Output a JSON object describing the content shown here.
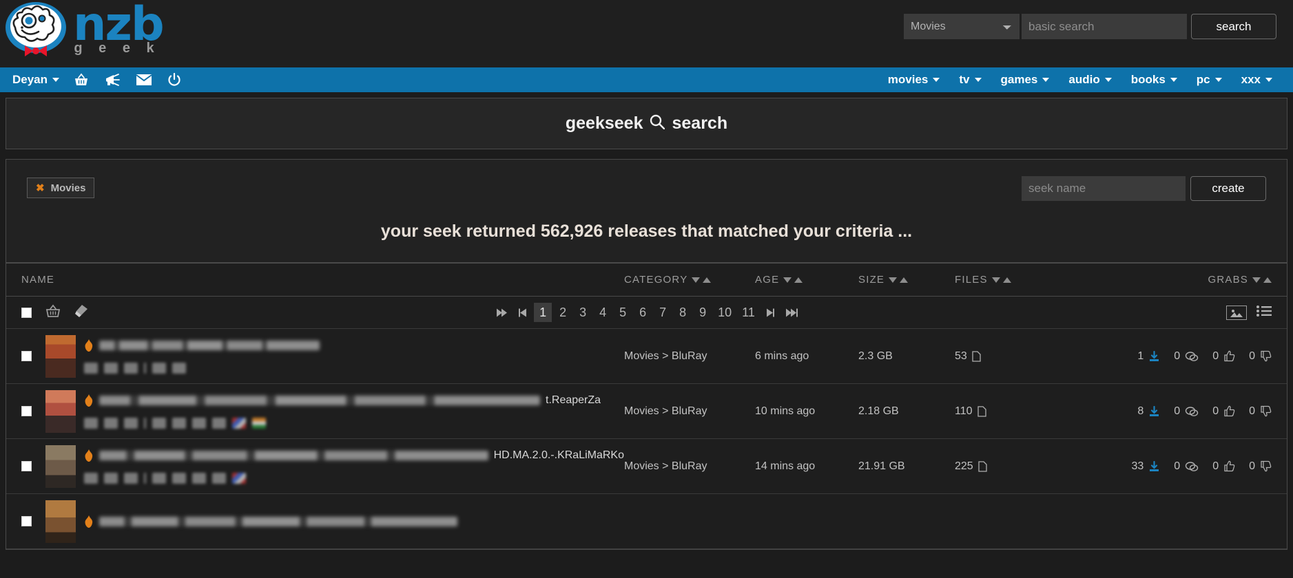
{
  "header": {
    "logo_primary": "nzb",
    "logo_secondary": "g e e k",
    "category_selected": "Movies",
    "search_placeholder": "basic search",
    "search_value": "",
    "search_button": "search"
  },
  "nav": {
    "user": "Deyan",
    "icons": [
      "basket-icon",
      "megaphone-icon",
      "envelope-icon",
      "power-icon"
    ],
    "items": [
      {
        "label": "movies"
      },
      {
        "label": "tv"
      },
      {
        "label": "games"
      },
      {
        "label": "audio"
      },
      {
        "label": "books"
      },
      {
        "label": "pc"
      },
      {
        "label": "xxx"
      }
    ]
  },
  "page": {
    "title_prefix": "geekseek",
    "title_icon": "⌕",
    "title_suffix": "search"
  },
  "filters": {
    "chips": [
      {
        "label": "Movies",
        "remove": "✖"
      }
    ],
    "seek_placeholder": "seek name",
    "seek_value": "",
    "create_button": "create"
  },
  "results": {
    "heading": "your seek returned 562,926 releases that matched your criteria ...",
    "columns": {
      "name": "NAME",
      "category": "CATEGORY",
      "age": "AGE",
      "size": "SIZE",
      "files": "FILES",
      "grabs": "GRABS"
    },
    "pagination": {
      "first": "⏮",
      "prev": "◀",
      "pages": [
        "1",
        "2",
        "3",
        "4",
        "5",
        "6",
        "7",
        "8",
        "9",
        "10",
        "11"
      ],
      "current": "1",
      "next": "▶",
      "last": "⏭"
    },
    "view_modes": [
      "covers-view-icon",
      "list-view-icon"
    ],
    "rows": [
      {
        "title_tail": "",
        "category": "Movies > BluRay",
        "age": "6 mins ago",
        "size": "2.3 GB",
        "files": "53",
        "grabs": "1",
        "comments": "0",
        "thumbs_up": "0",
        "thumbs_down": "0",
        "thumb_color": "#a8492a"
      },
      {
        "title_tail": "t.ReaperZa",
        "category": "Movies > BluRay",
        "age": "10 mins ago",
        "size": "2.18 GB",
        "files": "110",
        "grabs": "8",
        "comments": "0",
        "thumbs_up": "0",
        "thumbs_down": "0",
        "thumb_color": "#b05040"
      },
      {
        "title_tail": "HD.MA.2.0.-.KRaLiMaRKo",
        "category": "Movies > BluRay",
        "age": "14 mins ago",
        "size": "21.91 GB",
        "files": "225",
        "grabs": "33",
        "comments": "0",
        "thumbs_up": "0",
        "thumbs_down": "0",
        "thumb_color": "#6d5a48"
      },
      {
        "title_tail": "",
        "category": "",
        "age": "",
        "size": "",
        "files": "",
        "grabs": "",
        "comments": "",
        "thumbs_up": "",
        "thumbs_down": "",
        "thumb_color": "#7a5230"
      }
    ]
  },
  "colors": {
    "brand_blue": "#0e72aa",
    "logo_blue": "#1b83c0",
    "accent_orange": "#e2801a",
    "background": "#1c1c1c",
    "panel": "#262626"
  }
}
